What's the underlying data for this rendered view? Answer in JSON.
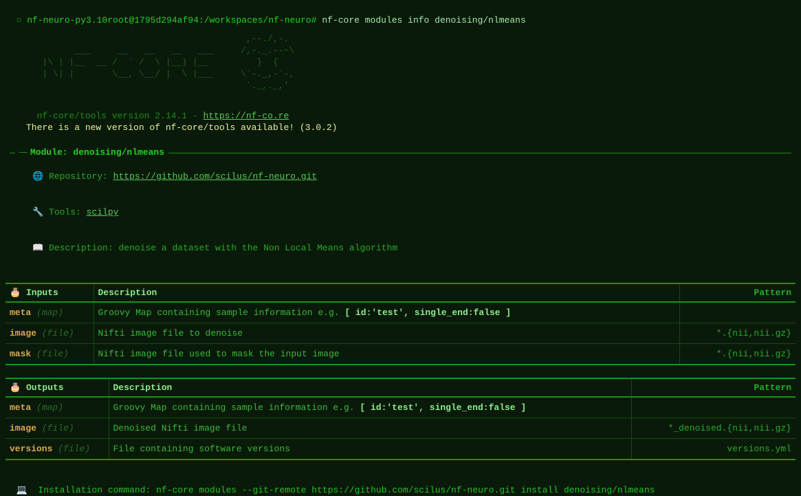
{
  "prompt": {
    "env": "nf-neuro-py3.10",
    "userhost": "root@1795d294af94",
    "cwd": "/workspaces/nf-neuro",
    "cmd": "nf-core modules info denoising/nlmeans"
  },
  "ascii_logo": "                                         ,--./,-.\n         ___     __   __   __   ___     /,-._.--~\\\n   |\\ | |__  __ /  ` /  \\ |__) |__         }  {\n   | \\| |       \\__, \\__/ |  \\ |___     \\`-._,-`-,\n                                         `._,._,'",
  "version": {
    "text": "nf-core/tools version 2.14.1 - ",
    "url": "https://nf-co.re"
  },
  "new_version": "There is a new version of nf-core/tools available! (3.0.2)",
  "module": {
    "title": "Module: denoising/nlmeans",
    "repo_label": "Repository:",
    "repo_url": "https://github.com/scilus/nf-neuro.git",
    "tools_label": "Tools:",
    "tools_link": "scilpy",
    "desc_label": "Description:",
    "desc_text": "denoise a dataset with the Non Local Means algorithm"
  },
  "inputs": {
    "header": {
      "name": "Inputs",
      "desc": "Description",
      "pattern": "Pattern"
    },
    "rows": [
      {
        "name": "meta",
        "type": "(map)",
        "desc": "Groovy Map containing sample information e.g. ",
        "code": "[ id:'test', single_end:false ]",
        "pattern": ""
      },
      {
        "name": "image",
        "type": "(file)",
        "desc": "Nifti image file to denoise",
        "code": "",
        "pattern": "*.{nii,nii.gz}"
      },
      {
        "name": "mask",
        "type": "(file)",
        "desc": "Nifti image file used to mask the input image",
        "code": "",
        "pattern": "*.{nii,nii.gz}"
      }
    ]
  },
  "outputs": {
    "header": {
      "name": "Outputs",
      "desc": "Description",
      "pattern": "Pattern"
    },
    "rows": [
      {
        "name": "meta",
        "type": "(map)",
        "desc": "Groovy Map containing sample information e.g. ",
        "code": "[ id:'test', single_end:false ]",
        "pattern": ""
      },
      {
        "name": "image",
        "type": "(file)",
        "desc": "Denoised Nifti image file",
        "code": "",
        "pattern": "*_denoised.{nii,nii.gz}"
      },
      {
        "name": "versions",
        "type": "(file)",
        "desc": "File containing software versions",
        "code": "",
        "pattern": "versions.yml"
      }
    ]
  },
  "install": {
    "label": "Installation command:",
    "cmd": "nf-core modules --git-remote https://github.com/scilus/nf-neuro.git install denoising/nlmeans"
  },
  "icons": {
    "globe": "🌐",
    "wrench": "🔧",
    "book": "📖",
    "cake": "🎂",
    "laptop": "💻"
  },
  "col_widths": {
    "inputs_name": "128px",
    "outputs_name": "150px"
  }
}
